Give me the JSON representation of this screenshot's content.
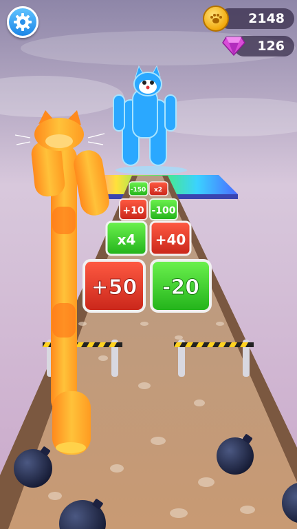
{
  "hud": {
    "coins": "2148",
    "gems": "126",
    "settings_icon": "gear-icon",
    "coin_icon": "paw-coin-icon",
    "gem_icon": "gem-icon"
  },
  "gates": {
    "row1": {
      "left": "+50",
      "right": "-20"
    },
    "row2": {
      "left": "x4",
      "right": "+40"
    },
    "row3": {
      "left": "+10",
      "right": "-100"
    },
    "row4": {
      "left": "-150",
      "right": "x2"
    }
  },
  "colors": {
    "gate_red": "#e23a2a",
    "gate_green": "#3fd12d",
    "cat_orange": "#ff9b21",
    "boss_blue": "#2aa8ff"
  }
}
